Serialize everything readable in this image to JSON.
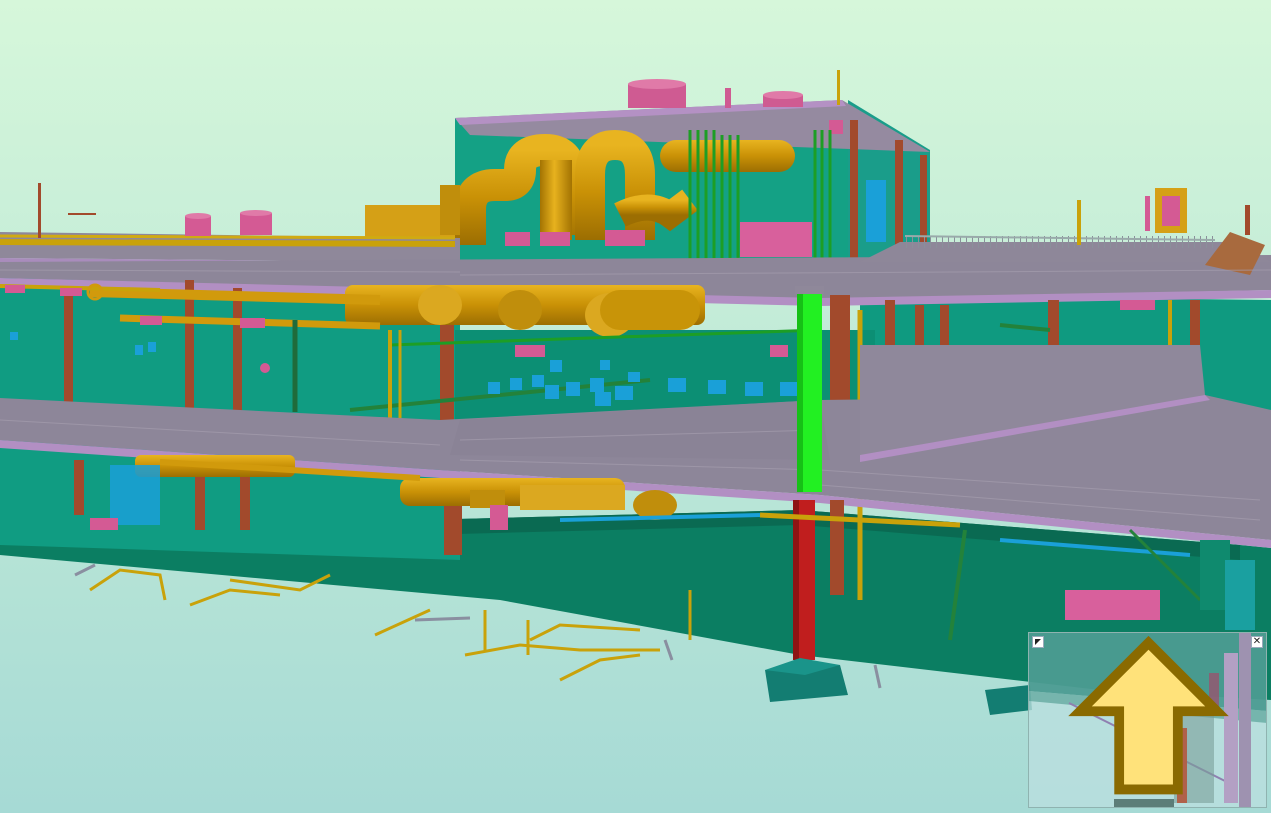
{
  "app": {
    "view_type": "3d-model-viewport"
  },
  "scene": {
    "sky_top_color": "#d5f6d9",
    "sky_bottom_color": "#a7dcd4",
    "colors": {
      "slab": "#8e8798",
      "slab_edge": "#b08dc0",
      "wall": "#0d9b80",
      "wall_dark": "#087a60",
      "column": "#a24a2c",
      "duct_gold": "#d19a0c",
      "pipe_yellow": "#c9a20a",
      "pink": "#d35a93",
      "blue": "#1aa0d8",
      "highlight": "#22f022",
      "red_column": "#c01e1e"
    }
  },
  "minimap": {
    "expand_icon": "corner-arrow-icon",
    "close_glyph": "✕",
    "cursor_icon": "pointer-arrow-icon"
  }
}
